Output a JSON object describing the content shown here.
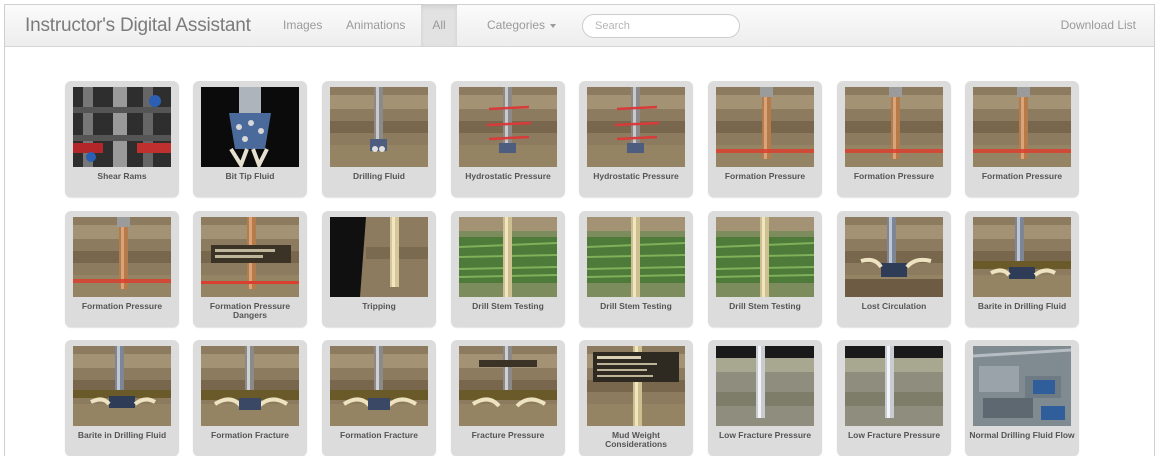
{
  "navbar": {
    "brand": "Instructor's Digital Assistant",
    "links": [
      {
        "label": "Images"
      },
      {
        "label": "Animations"
      },
      {
        "label": "All",
        "active": true
      }
    ],
    "categories_label": "Categories",
    "search_placeholder": "Search",
    "download_label": "Download List"
  },
  "tiles": [
    {
      "label": "Shear Rams",
      "icon": "shear-rams-thumbnail"
    },
    {
      "label": "Bit Tip Fluid",
      "icon": "bit-tip-fluid-thumbnail"
    },
    {
      "label": "Drilling Fluid",
      "icon": "drilling-fluid-thumbnail"
    },
    {
      "label": "Hydrostatic Pressure",
      "icon": "hydrostatic-pressure-thumbnail"
    },
    {
      "label": "Hydrostatic Pressure",
      "icon": "hydrostatic-pressure-thumbnail"
    },
    {
      "label": "Formation Pressure",
      "icon": "formation-pressure-thumbnail"
    },
    {
      "label": "Formation Pressure",
      "icon": "formation-pressure-thumbnail"
    },
    {
      "label": "Formation Pressure",
      "icon": "formation-pressure-thumbnail"
    },
    {
      "label": "Formation Pressure",
      "icon": "formation-pressure-thumbnail"
    },
    {
      "label": "Formation Pressure Dangers",
      "icon": "formation-pressure-dangers-thumbnail"
    },
    {
      "label": "Tripping",
      "icon": "tripping-thumbnail"
    },
    {
      "label": "Drill Stem Testing",
      "icon": "drill-stem-testing-thumbnail"
    },
    {
      "label": "Drill Stem Testing",
      "icon": "drill-stem-testing-thumbnail"
    },
    {
      "label": "Drill Stem Testing",
      "icon": "drill-stem-testing-thumbnail"
    },
    {
      "label": "Lost Circulation",
      "icon": "lost-circulation-thumbnail"
    },
    {
      "label": "Barite in Drilling Fluid",
      "icon": "barite-thumbnail"
    },
    {
      "label": "Barite in Drilling Fluid",
      "icon": "barite-thumbnail"
    },
    {
      "label": "Formation Fracture",
      "icon": "formation-fracture-thumbnail"
    },
    {
      "label": "Formation Fracture",
      "icon": "formation-fracture-thumbnail"
    },
    {
      "label": "Fracture Pressure",
      "icon": "fracture-pressure-thumbnail"
    },
    {
      "label": "Mud Weight Considerations",
      "icon": "mud-weight-thumbnail"
    },
    {
      "label": "Low Fracture Pressure",
      "icon": "low-fracture-pressure-thumbnail"
    },
    {
      "label": "Low Fracture Pressure",
      "icon": "low-fracture-pressure-thumbnail"
    },
    {
      "label": "Normal Drilling Fluid Flow",
      "icon": "normal-drilling-fluid-flow-thumbnail"
    }
  ]
}
